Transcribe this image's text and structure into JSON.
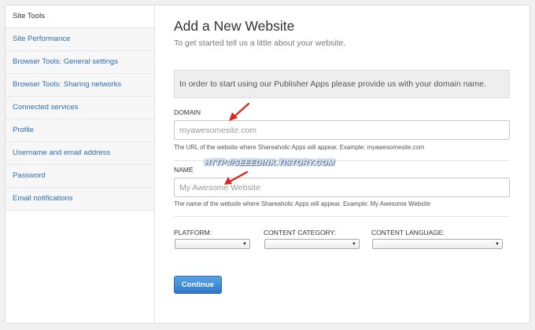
{
  "sidebar": {
    "items": [
      {
        "label": "Site Tools",
        "active": true
      },
      {
        "label": "Site Performance"
      },
      {
        "label": "Browser Tools: General settings"
      },
      {
        "label": "Browser Tools: Sharing networks"
      },
      {
        "label": "Connected services"
      },
      {
        "label": "Profile"
      },
      {
        "label": "Username and email address"
      },
      {
        "label": "Password"
      },
      {
        "label": "Email notifications"
      }
    ]
  },
  "main": {
    "title": "Add a New Website",
    "subtitle": "To get started tell us a little about your website.",
    "notice": "In order to start using our Publisher Apps please provide us with your domain name.",
    "domain": {
      "label": "DOMAIN",
      "placeholder": "myawesomesite.com",
      "help": "The URL of the website where Shareaholic Apps will appear. Example: myawesomesite.com"
    },
    "name": {
      "label": "NAME",
      "placeholder": "My Awesome Website",
      "help": "The name of the website where Shareaholic Apps will appear. Example: My Awesome Website"
    },
    "platform": {
      "label": "PLATFORM:",
      "value": ""
    },
    "content_category": {
      "label": "CONTENT CATEGORY:",
      "value": ""
    },
    "content_language": {
      "label": "CONTENT LANGUAGE:",
      "value": ""
    },
    "continue_label": "Continue"
  },
  "watermark": "HTTP://SEEEDINK.TISTORY.COM",
  "icons": {
    "caret": "triangle-down-icon",
    "annotation": "red-arrow-icon"
  },
  "colors": {
    "link": "#2d6cb5",
    "button": "#2f78c8",
    "arrow": "#d9251c"
  }
}
